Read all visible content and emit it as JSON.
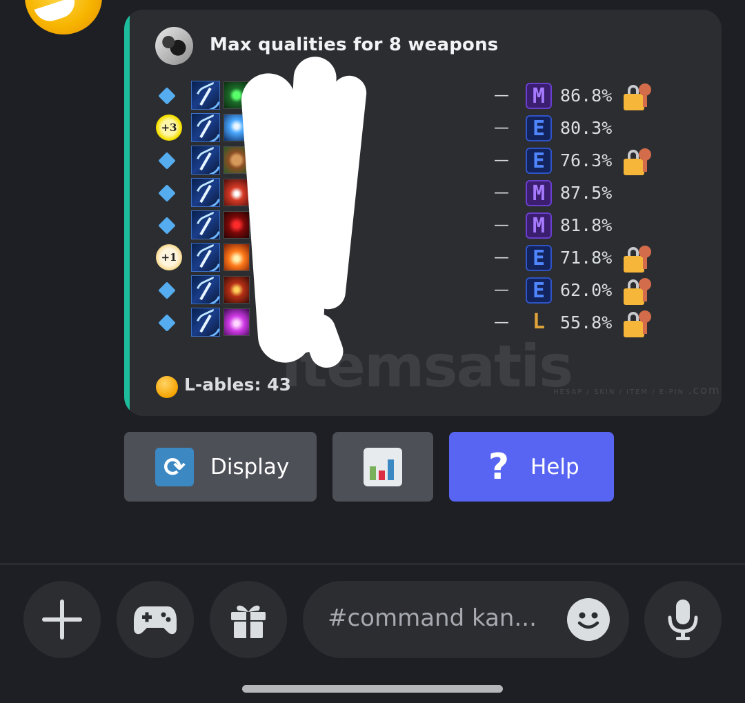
{
  "embed": {
    "title": "Max qualities for 8 weapons",
    "accent_color": "#1dbc9c",
    "rows": [
      {
        "badge": "diamond",
        "talent_icon": "green-heart-icon",
        "tier": "M",
        "percent": "86.8%",
        "locked": true
      },
      {
        "badge": "+3",
        "badge_color": "yellow",
        "talent_icon": "meditation-icon",
        "tier": "E",
        "percent": "80.3%",
        "locked": false
      },
      {
        "badge": "diamond",
        "talent_icon": "earth-icon",
        "tier": "E",
        "percent": "76.3%",
        "locked": true
      },
      {
        "badge": "diamond",
        "talent_icon": "fang-icon",
        "tier": "M",
        "percent": "87.5%",
        "locked": false
      },
      {
        "badge": "diamond",
        "talent_icon": "blood-rune-icon",
        "tier": "M",
        "percent": "81.8%",
        "locked": false
      },
      {
        "badge": "+1",
        "badge_color": "cream",
        "talent_icon": "fire-figure-icon",
        "tier": "E",
        "percent": "71.8%",
        "locked": true
      },
      {
        "badge": "diamond",
        "talent_icon": "target-icon",
        "tier": "E",
        "percent": "62.0%",
        "locked": true
      },
      {
        "badge": "diamond",
        "talent_icon": "purple-hand-icon",
        "tier": "L",
        "percent": "55.8%",
        "locked": true
      }
    ],
    "dash": "—",
    "footer": "L-ables: 43"
  },
  "watermark": {
    "text": "itemsatis",
    "sub": "HESAP / SKIN / ITEM / E-PIN",
    "suffix": ".com"
  },
  "buttons": {
    "display": "Display",
    "help": "Help",
    "help_glyph": "?",
    "display_glyph": "⟳"
  },
  "composer": {
    "placeholder": "#command kan..."
  },
  "colors": {
    "help_button": "#5865f2",
    "secondary_button": "#4e5058",
    "background": "#1e1f24"
  }
}
